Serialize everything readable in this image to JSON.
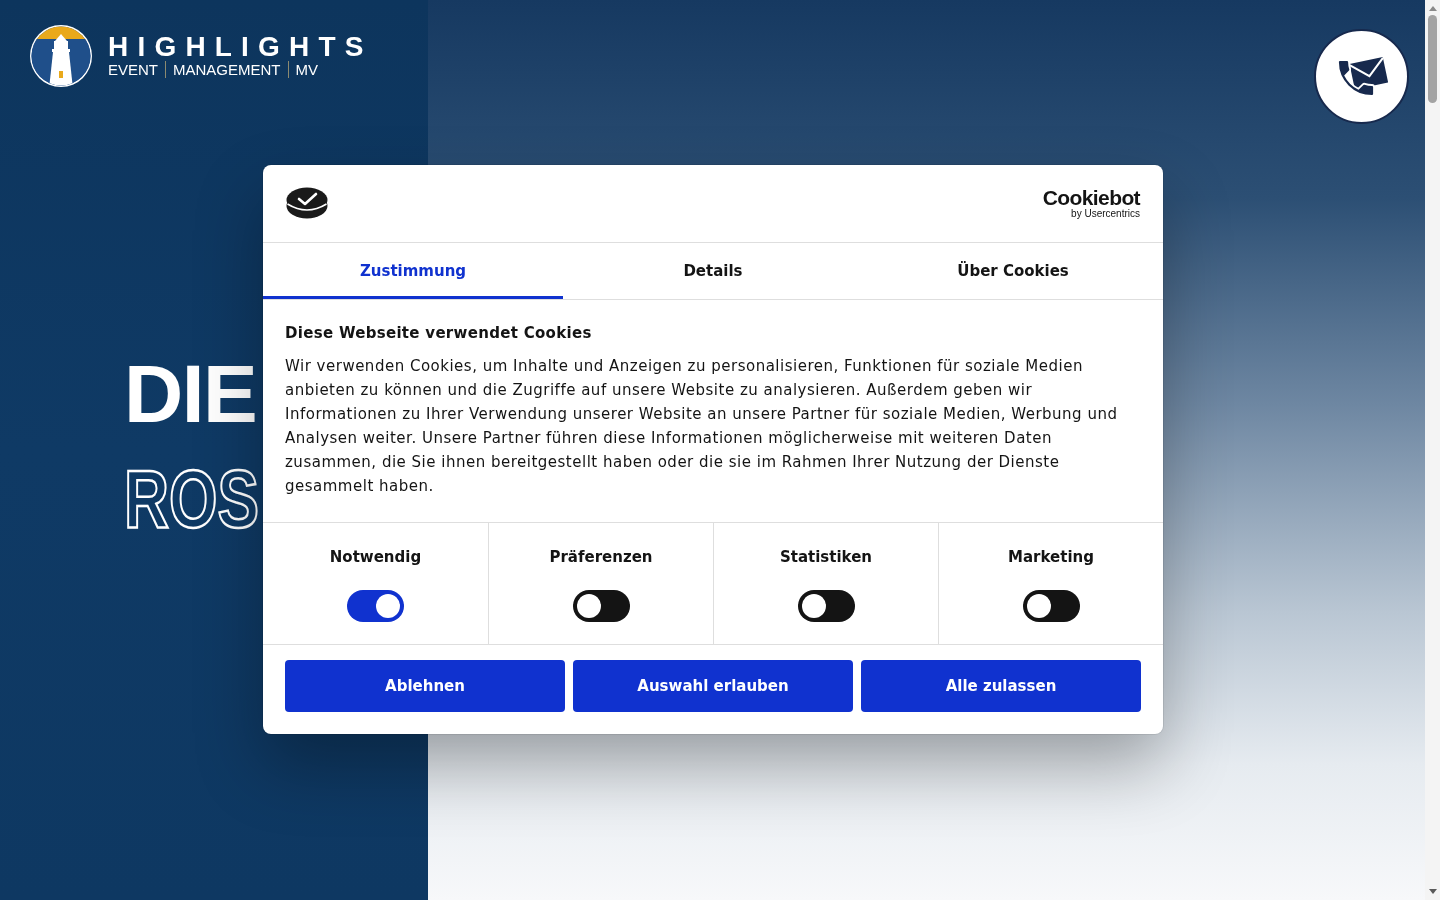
{
  "logo": {
    "wordmark": "HIGHLIGHTS",
    "tagline": [
      "EVENT",
      "MANAGEMENT",
      "MV"
    ]
  },
  "hero": {
    "heading_lines": [
      {
        "text": "DIE",
        "kind": "solid"
      },
      {
        "text": "ROS",
        "kind": "outline"
      }
    ]
  },
  "cookie_dialog": {
    "brand": {
      "name": "Cookiebot",
      "byline": "by Usercentrics"
    },
    "tabs": [
      {
        "label": "Zustimmung",
        "selected": true
      },
      {
        "label": "Details",
        "selected": false
      },
      {
        "label": "Über Cookies",
        "selected": false
      }
    ],
    "title": "Diese Webseite verwendet Cookies",
    "text": "Wir verwenden Cookies, um Inhalte und Anzeigen zu personalisieren, Funktionen für soziale Medien anbieten zu können und die Zugriffe auf unsere Website zu analysieren. Außerdem geben wir Informationen zu Ihrer Verwendung unserer Website an unsere Partner für soziale Medien, Werbung und Analysen weiter. Unsere Partner führen diese Informationen möglicherweise mit weiteren Daten zusammen, die Sie ihnen bereitgestellt haben oder die sie im Rahmen Ihrer Nutzung der Dienste gesammelt haben.",
    "categories": [
      {
        "label": "Notwendig",
        "on": true
      },
      {
        "label": "Präferenzen",
        "on": false
      },
      {
        "label": "Statistiken",
        "on": false
      },
      {
        "label": "Marketing",
        "on": false
      }
    ],
    "buttons": [
      "Ablehnen",
      "Auswahl erlauben",
      "Alle zulassen"
    ]
  }
}
